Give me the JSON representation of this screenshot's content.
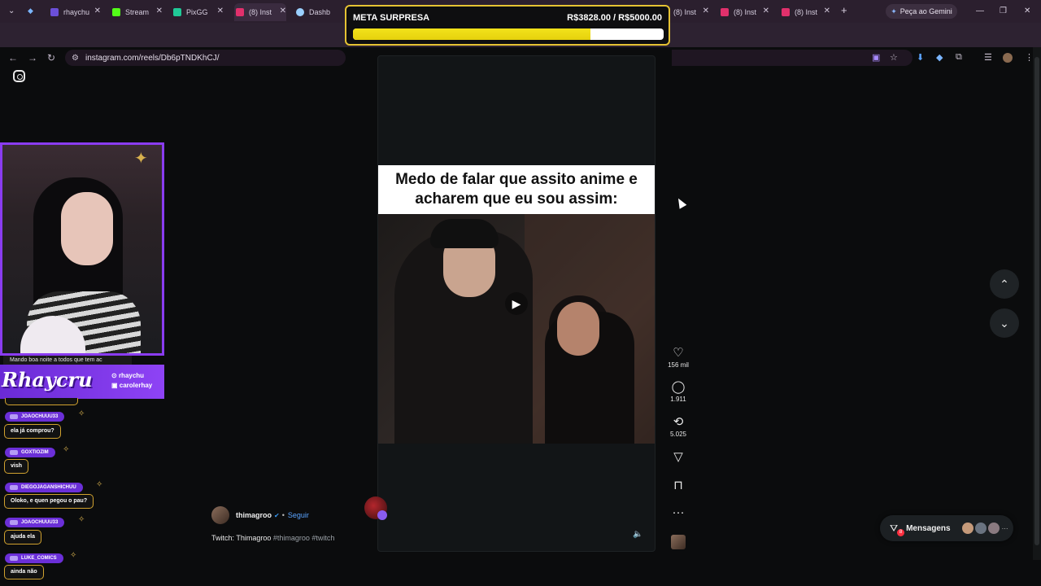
{
  "browser": {
    "tabs": [
      {
        "label": "rhaychu",
        "color": "#6b4fd8"
      },
      {
        "label": "Stream",
        "color": "#53fc18"
      },
      {
        "label": "PixGG",
        "color": "#20c997"
      },
      {
        "label": "(8) Inst",
        "color": "#e1306c"
      },
      {
        "label": "Dashb",
        "color": "#9ad0ff"
      },
      {
        "label": "(8) Inst",
        "color": "#e1306c"
      },
      {
        "label": "(8) Inst",
        "color": "#e1306c"
      },
      {
        "label": "(8) Inst",
        "color": "#e1306c"
      }
    ],
    "url": "instagram.com/reels/Db6pTNDKhCJ/",
    "gemini_label": "Peça ao Gemini"
  },
  "goal": {
    "title": "META SURPRESA",
    "amount": "R$3828.00 / R$5000.00",
    "progress": 0.7656
  },
  "reel": {
    "caption": "Medo de falar que assito anime e acharem que eu sou assim:",
    "likes": "156 mil",
    "comments": "1.911",
    "reposts": "5.025",
    "author": "thimagroo",
    "follow_label": "Seguir",
    "description": "Twitch: Thimagroo",
    "hashtags": "#thimagroo #twitch"
  },
  "messages": {
    "label": "Mensagens",
    "badge": "8"
  },
  "stream_overlay": {
    "brand": "Rhaycru",
    "handles": [
      "rhaychu",
      "carolerhay"
    ],
    "ticker": "Mando boa noite a todos que tem ac",
    "chat": [
      {
        "user": "JOAOCHUUU33",
        "message": "ela já comprou?"
      },
      {
        "user": "GOXTIOZIM",
        "message": "vish"
      },
      {
        "user": "DIEGOJAGANSHICHUU",
        "message": "Oloko, e quen pegou o pau?"
      },
      {
        "user": "JOAOCHUUU33",
        "message": "ajuda ela"
      },
      {
        "user": "LUKE_COMICS",
        "message": "ainda não"
      }
    ]
  }
}
